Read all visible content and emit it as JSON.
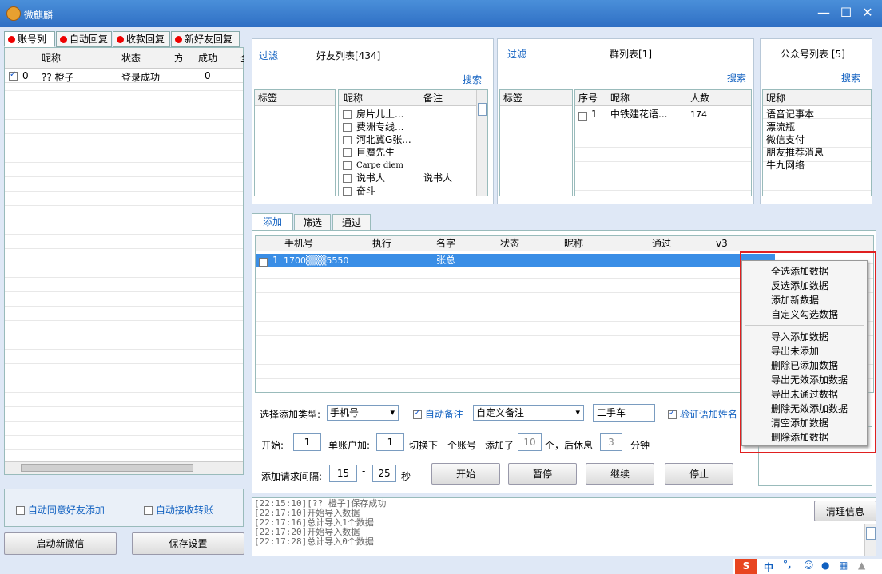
{
  "app": {
    "title": "微麒麟"
  },
  "window_buttons": {
    "minimize": "—",
    "maximize": "☐",
    "close": "✕"
  },
  "account_tabs": [
    "账号列",
    "自动回复",
    "收款回复",
    "新好友回复"
  ],
  "account_table": {
    "headers": [
      "昵称",
      "状态",
      "方",
      "成功",
      "全"
    ],
    "row": {
      "index": "0",
      "nick": "?? 橙子",
      "status": "登录成功",
      "success": "0"
    }
  },
  "left_bottom": {
    "auto_agree": "自动同意好友添加",
    "auto_transfer": "自动接收转账",
    "start_btn": "启动新微信",
    "save_btn": "保存设置"
  },
  "friends": {
    "filter": "过滤",
    "title": "好友列表[434]",
    "search": "搜索",
    "tag_header": "标签",
    "col_nick": "昵称",
    "col_note": "备注",
    "rows": [
      {
        "nick": "房片儿上...",
        "note": ""
      },
      {
        "nick": "费洲专线...",
        "note": ""
      },
      {
        "nick": "河北冀G张...",
        "note": ""
      },
      {
        "nick": "巨魔先生",
        "note": ""
      },
      {
        "nick": "Carpe diem",
        "note": ""
      },
      {
        "nick": "说书人",
        "note": "说书人"
      },
      {
        "nick": "奋斗",
        "note": ""
      }
    ]
  },
  "groups": {
    "filter": "过滤",
    "title": "群列表[1]",
    "search": "搜索",
    "tag_header": "标签",
    "col_seq": "序号",
    "col_nick": "昵称",
    "col_count": "人数",
    "rows": [
      {
        "seq": "1",
        "nick": "中铁建花语...",
        "count": "174"
      }
    ]
  },
  "official": {
    "title": "公众号列表 [5]",
    "search": "搜索",
    "col_nick": "昵称",
    "rows": [
      "语音记事本",
      "漂流瓶",
      "微信支付",
      "朋友推荐消息",
      "牛九网络"
    ]
  },
  "main_tabs": [
    "添加",
    "筛选",
    "通过"
  ],
  "add_table": {
    "headers": [
      "手机号",
      "执行",
      "名字",
      "状态",
      "昵称",
      "通过",
      "v3"
    ],
    "row": {
      "index": "1",
      "phone": "1700▒▒▒5550",
      "name": "张总"
    }
  },
  "context_menu": {
    "group1": [
      "全选添加数据",
      "反选添加数据",
      "添加新数据",
      "自定义勾选数据"
    ],
    "group2": [
      "导入添加数据",
      "导出未添加",
      "删除已添加数据",
      "导出无效添加数据",
      "导出未通过数据",
      "删除无效添加数据",
      "清空添加数据",
      "删除添加数据"
    ]
  },
  "controls": {
    "type_label": "选择添加类型:",
    "type_value": "手机号",
    "auto_note": "自动备注",
    "note_select": "自定义备注",
    "note_text": "二手车",
    "verify_add_name": "验证语加姓名",
    "start_label": "开始:",
    "start_value": "1",
    "per_account": "单账户加:",
    "per_value": "1",
    "switch_label": "切换下一个账号",
    "added_label": "添加了",
    "added_value": "10",
    "rest_label": "个，后休息",
    "rest_value": "3",
    "minute": "分钟",
    "interval_label": "添加请求间隔:",
    "interval_from": "15",
    "dash": "-",
    "interval_to": "25",
    "sec": "秒",
    "btn_start": "开始",
    "btn_pause": "暂停",
    "btn_continue": "继续",
    "btn_stop": "停止"
  },
  "log": {
    "lines": [
      "[22:15:10][?? 橙子]保存成功",
      "[22:17:10]开始导入数据",
      "[22:17:16]总计导入1个数据",
      "[22:17:20]开始导入数据",
      "[22:17:28]总计导入0个数据"
    ],
    "clear_btn": "清理信息"
  },
  "tray": {
    "ime": "中",
    "punct": "°,"
  },
  "colors": {
    "title_bar": "#2f6fc4",
    "selection": "#3a8ee6",
    "highlight_box": "#e02020"
  }
}
